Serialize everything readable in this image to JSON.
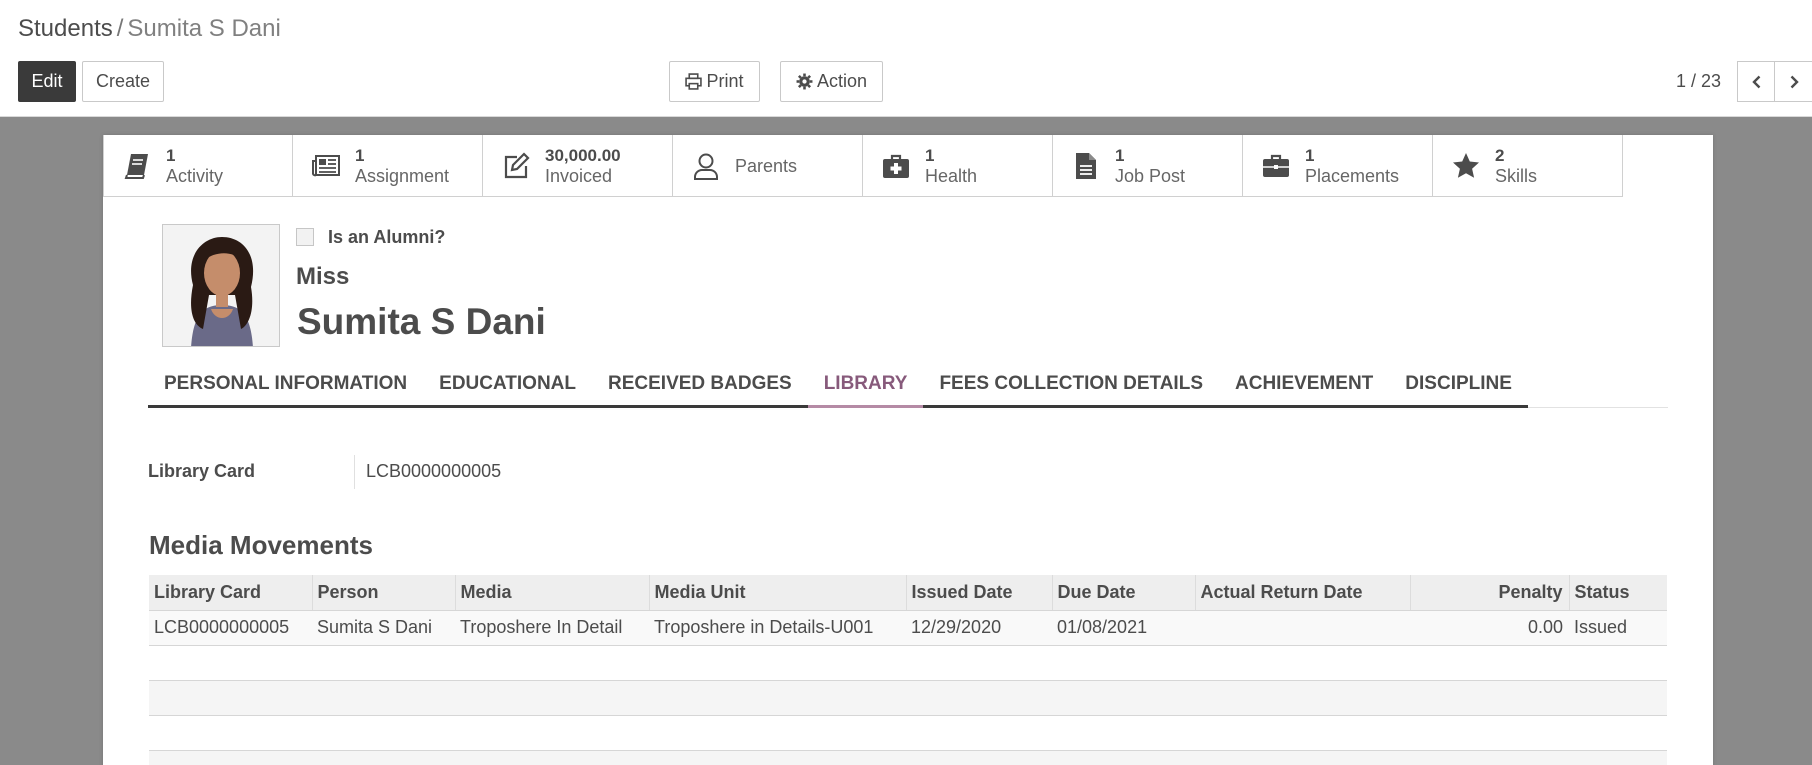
{
  "breadcrumb": {
    "parent": "Students",
    "separator": "/",
    "current": "Sumita S Dani"
  },
  "toolbar": {
    "edit_label": "Edit",
    "create_label": "Create",
    "print_label": "Print",
    "action_label": "Action"
  },
  "pager": {
    "value": "1 / 23"
  },
  "smart_buttons": [
    {
      "value": "1",
      "label": "Activity",
      "icon": "book-icon"
    },
    {
      "value": "1",
      "label": "Assignment",
      "icon": "newspaper-icon"
    },
    {
      "value": "30,000.00",
      "label": "Invoiced",
      "icon": "edit-icon"
    },
    {
      "value": "",
      "label": "Parents",
      "icon": "user-icon"
    },
    {
      "value": "1",
      "label": "Health",
      "icon": "medkit-icon"
    },
    {
      "value": "1",
      "label": "Job Post",
      "icon": "file-icon"
    },
    {
      "value": "1",
      "label": "Placements",
      "icon": "briefcase-icon"
    },
    {
      "value": "2",
      "label": "Skills",
      "icon": "star-icon"
    }
  ],
  "student": {
    "is_alumni_label": "Is an Alumni?",
    "title": "Miss",
    "name": "Sumita  S  Dani"
  },
  "tabs": [
    {
      "label": "PERSONAL INFORMATION"
    },
    {
      "label": "EDUCATIONAL"
    },
    {
      "label": "RECEIVED BADGES"
    },
    {
      "label": "LIBRARY"
    },
    {
      "label": "FEES COLLECTION DETAILS"
    },
    {
      "label": "ACHIEVEMENT"
    },
    {
      "label": "DISCIPLINE"
    }
  ],
  "active_tab": "LIBRARY",
  "library": {
    "card_label": "Library Card",
    "card_value": "LCB0000000005",
    "section_title": "Media Movements",
    "columns": [
      "Library Card",
      "Person",
      "Media",
      "Media Unit",
      "Issued Date",
      "Due Date",
      "Actual Return Date",
      "Penalty",
      "Status"
    ],
    "rows": [
      {
        "library_card": "LCB0000000005",
        "person": "Sumita S Dani",
        "media": "Troposhere In Detail",
        "media_unit": "Troposhere in Details-U001",
        "issued_date": "12/29/2020",
        "due_date": "01/08/2021",
        "actual_return_date": "",
        "penalty": "0.00",
        "status": "Issued"
      }
    ]
  },
  "colors": {
    "accent": "#875a7b",
    "primary_button": "#3a3a3a",
    "backdrop": "#8a8a8a"
  }
}
